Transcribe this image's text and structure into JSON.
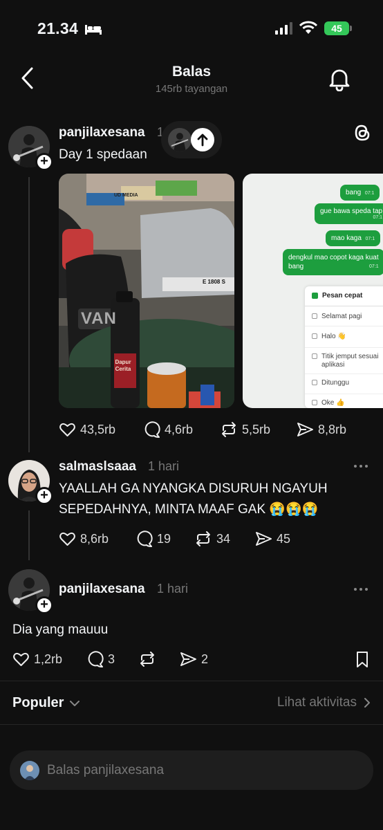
{
  "status_bar": {
    "time": "21.34",
    "battery": "45"
  },
  "header": {
    "title": "Balas",
    "subtitle": "145rb tayangan"
  },
  "post": {
    "username": "panjilaxesana",
    "time_partial": "1",
    "text": "Day 1 spedaan",
    "image1": {
      "cap_text": "Dapur Cerita",
      "sign_text": "UD MEDIA",
      "plate": "E 1808 S",
      "bag_text": "VAN"
    },
    "chat": {
      "bubbles": [
        {
          "text": "bang",
          "time": "07:1"
        },
        {
          "text": "gue bawa speda tap",
          "time": "07:1"
        },
        {
          "text": "mao kaga",
          "time": "07:1"
        },
        {
          "text": "dengkul mao copot kaga kuat",
          "text2": "bang",
          "time": "07:1"
        }
      ],
      "quick_reply_title": "Pesan cepat",
      "quick_replies": [
        "Selamat pagi",
        "Halo 👋",
        "Titik jemput sesuai",
        "aplikasi",
        "Ditunggu",
        "Oke 👍"
      ]
    },
    "stats": {
      "likes": "43,5rb",
      "comments": "4,6rb",
      "reposts": "5,5rb",
      "shares": "8,8rb"
    }
  },
  "reply1": {
    "username": "salmaslsaaa",
    "time": "1 hari",
    "text": "YAALLAH GA NYANGKA DISURUH NGAYUH SEPEDAHNYA, MINTA MAAF GAK 😭😭😭",
    "stats": {
      "likes": "8,6rb",
      "comments": "19",
      "reposts": "34",
      "shares": "45"
    }
  },
  "reply2": {
    "username": "panjilaxesana",
    "time": "1 hari",
    "text": "Dia yang mauuu",
    "stats": {
      "likes": "1,2rb",
      "comments": "3",
      "shares": "2"
    }
  },
  "sort": {
    "label": "Populer",
    "activity_link": "Lihat aktivitas"
  },
  "composer": {
    "placeholder": "Balas panjilaxesana"
  },
  "colors": {
    "background": "#101010",
    "chat_bubble": "#1d9e3e",
    "battery": "#34c759"
  }
}
